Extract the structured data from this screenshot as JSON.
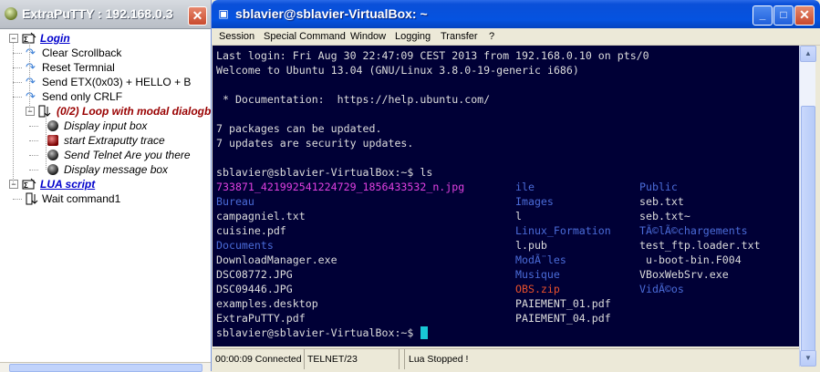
{
  "left_window": {
    "title": "ExtraPuTTY : 192.168.0.3",
    "close_glyph": "✕",
    "tree": [
      {
        "kind": "group",
        "label": "Login",
        "color": "#0000cc",
        "expanded": "−"
      },
      {
        "kind": "command",
        "label": "Clear Scrollback"
      },
      {
        "kind": "command",
        "label": "Reset Termnial"
      },
      {
        "kind": "command",
        "label": "Send ETX(0x03) + HELLO + B"
      },
      {
        "kind": "command",
        "label": "Send only CRLF"
      },
      {
        "kind": "loop",
        "label": "(0/2) Loop with modal dialogb",
        "color": "#990000",
        "expanded": "−"
      },
      {
        "kind": "step",
        "label": "Display input box"
      },
      {
        "kind": "step",
        "label": "start Extraputty trace"
      },
      {
        "kind": "step",
        "label": "Send Telnet Are you there"
      },
      {
        "kind": "step",
        "label": "Display message box"
      },
      {
        "kind": "group",
        "label": "LUA script",
        "color": "#0000cc",
        "expanded": "−"
      },
      {
        "kind": "wait",
        "label": "Wait command1"
      }
    ]
  },
  "putty": {
    "title": "sblavier@sblavier-VirtualBox: ~",
    "window_buttons": {
      "minimize": "_",
      "maximize": "□",
      "close": "✕"
    },
    "menu": [
      "Session",
      "Special Command",
      "Window",
      "Logging",
      "Transfer",
      "?"
    ],
    "terminal_lines": [
      "Last login: Fri Aug 30 22:47:09 CEST 2013 from 192.168.0.10 on pts/0",
      "Welcome to Ubuntu 13.04 (GNU/Linux 3.8.0-19-generic i686)",
      "",
      " * Documentation:  https://help.ubuntu.com/",
      "",
      "7 packages can be updated.",
      "7 updates are security updates.",
      "",
      "sblavier@sblavier-VirtualBox:~$ ls"
    ],
    "ls_rows": [
      [
        {
          "t": "733871_421992541224729_1856433532_n.jpg",
          "c": "#e040e0"
        },
        {
          "t": "ile",
          "c": "#4a6bd8"
        },
        {
          "t": "Public",
          "c": "#4a6bd8"
        }
      ],
      [
        {
          "t": "Bureau",
          "c": "#4a6bd8"
        },
        {
          "t": "Images",
          "c": "#4a6bd8"
        },
        {
          "t": "seb.txt",
          "c": "#dcdcdc"
        }
      ],
      [
        {
          "t": "campagniel.txt",
          "c": "#dcdcdc"
        },
        {
          "t": "l",
          "c": "#dcdcdc"
        },
        {
          "t": "seb.txt~",
          "c": "#dcdcdc"
        }
      ],
      [
        {
          "t": "cuisine.pdf",
          "c": "#dcdcdc"
        },
        {
          "t": "Linux_Formation",
          "c": "#4a6bd8"
        },
        {
          "t": "TÃ©lÃ©chargements",
          "c": "#4a6bd8"
        }
      ],
      [
        {
          "t": "Documents",
          "c": "#4a6bd8"
        },
        {
          "t": "l.pub",
          "c": "#dcdcdc"
        },
        {
          "t": "test_ftp.loader.txt",
          "c": "#dcdcdc"
        }
      ],
      [
        {
          "t": "DownloadManager.exe",
          "c": "#dcdcdc"
        },
        {
          "t": "ModÃ¨les",
          "c": "#4a6bd8"
        },
        {
          "t": " u-boot-bin.F004",
          "c": "#dcdcdc"
        }
      ],
      [
        {
          "t": "DSC08772.JPG",
          "c": "#dcdcdc"
        },
        {
          "t": "Musique",
          "c": "#4a6bd8"
        },
        {
          "t": "VBoxWebSrv.exe",
          "c": "#dcdcdc"
        }
      ],
      [
        {
          "t": "DSC09446.JPG",
          "c": "#dcdcdc"
        },
        {
          "t": "OBS.zip",
          "c": "#e8502c"
        },
        {
          "t": "VidÃ©os",
          "c": "#4a6bd8"
        }
      ],
      [
        {
          "t": "examples.desktop",
          "c": "#dcdcdc"
        },
        {
          "t": "PAIEMENT_01.pdf",
          "c": "#dcdcdc"
        },
        {
          "t": "",
          "c": "#dcdcdc"
        }
      ],
      [
        {
          "t": "ExtraPuTTY.pdf",
          "c": "#dcdcdc"
        },
        {
          "t": "PAIEMENT_04.pdf",
          "c": "#dcdcdc"
        },
        {
          "t": "",
          "c": "#dcdcdc"
        }
      ]
    ],
    "prompt": "sblavier@sblavier-VirtualBox:~$ ",
    "status": {
      "elapsed": "00:00:09 Connected",
      "protocol": "TELNET/23",
      "extra": "",
      "lua": "Lua Stopped !"
    }
  }
}
